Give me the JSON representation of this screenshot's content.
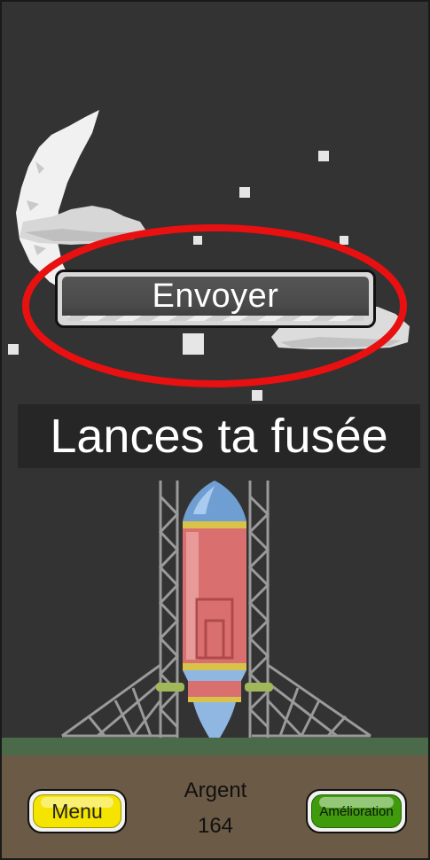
{
  "scene": {
    "sky_color": "#333333",
    "ground_color": "#6b5b46",
    "grass_color": "#4a6a4a",
    "highlight_color": "#e81010",
    "decor": [
      "moon",
      "cloud",
      "stars",
      "rocket",
      "launch-tower"
    ]
  },
  "launch_button": {
    "label": "Envoyer"
  },
  "title": {
    "text": "Lances ta fusée"
  },
  "bottom_bar": {
    "menu_label": "Menu",
    "money_label": "Argent",
    "money_value": "164",
    "upgrade_label": "Amélioration"
  }
}
